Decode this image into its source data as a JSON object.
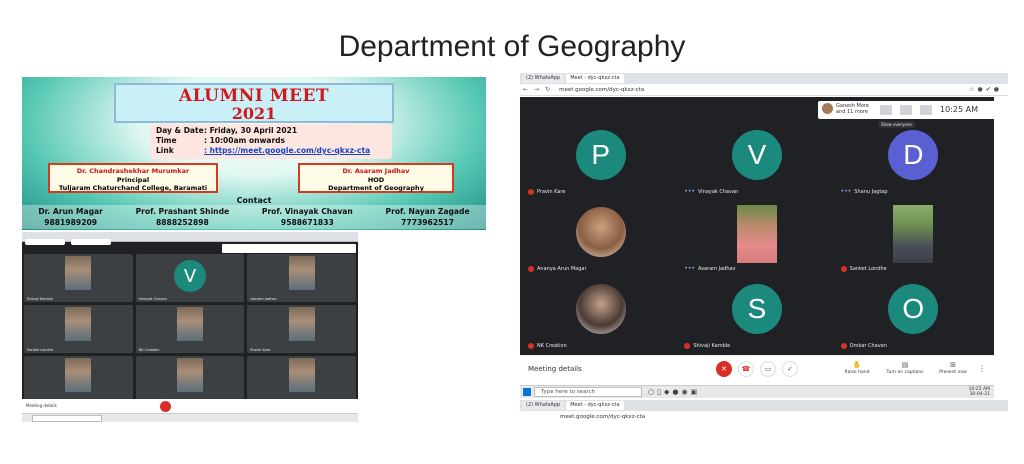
{
  "page": {
    "title": "Department of Geography"
  },
  "poster": {
    "title_line1": "ALUMNI MEET",
    "title_line2": "2021",
    "info": [
      {
        "label": "Day & Date",
        "value": ": Friday, 30 April 2021"
      },
      {
        "label": "Time",
        "value": ": 10:00am onwards"
      },
      {
        "label": "Link",
        "value": ": https://meet.google.com/dyc-qkxz-cta"
      }
    ],
    "principal": {
      "name": "Dr. Chandrashekhar  Murumkar",
      "role": "Principal",
      "org": "Tuljaram Chaturchand College, Baramati"
    },
    "hod": {
      "name": "Dr. Asaram  Jadhav",
      "role": "HOD",
      "org": "Department of Geography"
    },
    "contact_heading": "Contact",
    "contacts": [
      {
        "name": "Dr. Arun Magar",
        "phone": "9881989209"
      },
      {
        "name": "Prof. Prashant Shinde",
        "phone": "8888252898"
      },
      {
        "name": "Prof. Vinayak Chavan",
        "phone": "9588671833"
      },
      {
        "name": "Prof. Nayan Zagade",
        "phone": "7773962517"
      }
    ]
  },
  "small_meet": {
    "avatar_letter": "V",
    "tiles": [
      {
        "name": "Shivaji Kamble",
        "type": "photo"
      },
      {
        "name": "Vinayak Chavan",
        "type": "avatar"
      },
      {
        "name": "Asaram Jadhav",
        "type": "photo"
      },
      {
        "name": "Sanket Londhe",
        "type": "photo"
      },
      {
        "name": "NK Creation",
        "type": "photo"
      },
      {
        "name": "Pravin Kare",
        "type": "photo"
      },
      {
        "name": "Suresh More",
        "type": "photo"
      },
      {
        "name": "Sandeep Bhosale",
        "type": "photo"
      },
      {
        "name": "Shanu Jagtap",
        "type": "photo"
      }
    ],
    "meeting_details": "Meeting details",
    "taskbar_search": "Type here to search"
  },
  "big_meet": {
    "tabs": [
      {
        "label": "(2) WhatsApp",
        "active": false
      },
      {
        "label": "Meet - dyc-qkxz-cta",
        "active": true
      }
    ],
    "url": "meet.google.com/dyc-qkxz-cta",
    "others": {
      "line1": "Ganesh More",
      "line2": "and 11 more"
    },
    "time": "10:25 AM",
    "show_everyone_chip": "Show everyone",
    "tiles": [
      {
        "name": "Pravin Kare",
        "type": "avatar",
        "letter": "P",
        "color": "#1b8a7c",
        "muted": true
      },
      {
        "name": "Vinayak Chavan",
        "type": "avatar",
        "letter": "V",
        "color": "#1b8a7c",
        "muted": false
      },
      {
        "name": "Shanu Jagtap",
        "type": "avatar",
        "letter": "D",
        "color": "#5a5fd1",
        "muted": false
      },
      {
        "name": "Ananya Arun Magar",
        "type": "photo-round",
        "muted": true
      },
      {
        "name": "Asaram Jadhav",
        "type": "photo",
        "muted": false
      },
      {
        "name": "Sanket Londhe",
        "type": "photo",
        "muted": true
      },
      {
        "name": "NK Creation",
        "type": "photo-round",
        "muted": true
      },
      {
        "name": "Shivaji Kamble",
        "type": "avatar",
        "letter": "S",
        "color": "#1b8a7c",
        "muted": true
      },
      {
        "name": "Omkar Chavan",
        "type": "avatar",
        "letter": "O",
        "color": "#1b8a7c",
        "muted": true
      }
    ],
    "controls": {
      "meeting_details": "Meeting details",
      "raise_hand": "Raise hand",
      "captions": "Turn on captions",
      "present": "Present now"
    },
    "taskbar": {
      "search": "Type here to search",
      "clock_time": "10:25 AM",
      "clock_date": "30-04-21"
    },
    "tabs2": [
      {
        "label": "(2) WhatsApp",
        "active": false
      },
      {
        "label": "Meet - dyc-qkxz-cta",
        "active": true
      }
    ],
    "url2": "meet.google.com/dyc-qkxz-cta"
  }
}
